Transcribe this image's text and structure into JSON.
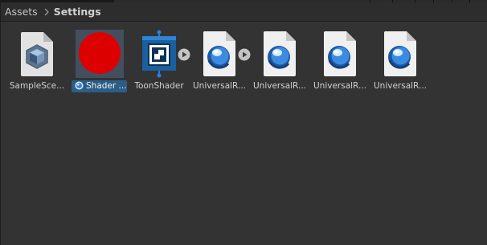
{
  "breadcrumb": {
    "root": "Assets",
    "current": "Settings"
  },
  "colors": {
    "background": "#333333",
    "selection": "#2c5d87",
    "shader_red": "#dd0000",
    "toon_blue": "#1f6fb8",
    "sphere_blue": "#3a86d4"
  },
  "assets": [
    {
      "label": "SampleSce...",
      "icon": "scene-template-icon"
    },
    {
      "label": "Shader ...",
      "icon": "shader-graph-icon",
      "selected": true
    },
    {
      "label": "ToonShader",
      "icon": "toon-shader-icon"
    },
    {
      "label": "UniversalR...",
      "icon": "urp-asset-icon"
    },
    {
      "label": "UniversalR...",
      "icon": "urp-asset-icon"
    },
    {
      "label": "UniversalR...",
      "icon": "urp-asset-icon"
    },
    {
      "label": "UniversalR...",
      "icon": "urp-asset-icon"
    }
  ],
  "expand_buttons": [
    "expand-arrow-icon",
    "expand-arrow-icon"
  ]
}
